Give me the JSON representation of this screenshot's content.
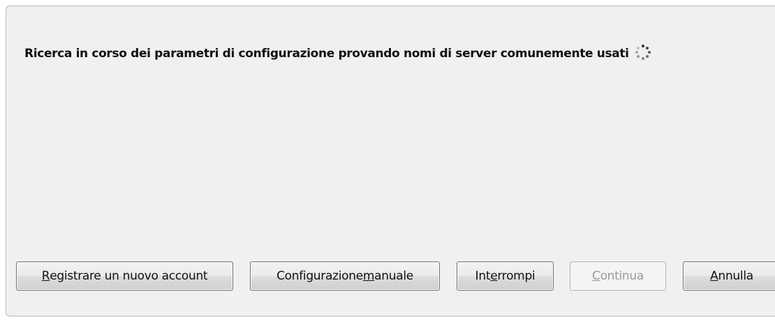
{
  "status": {
    "text": "Ricerca in corso dei parametri di configurazione provando nomi di server comunemente usati",
    "spinner_icon": "loading-spinner-icon"
  },
  "buttons": {
    "register": {
      "pre": "",
      "accel": "R",
      "post": "egistrare un nuovo account",
      "enabled": true
    },
    "manual": {
      "pre": "Configurazione ",
      "accel": "m",
      "post": "anuale",
      "enabled": true
    },
    "stop": {
      "pre": "Int",
      "accel": "e",
      "post": "rrompi",
      "enabled": true
    },
    "continue": {
      "pre": "",
      "accel": "C",
      "post": "ontinua",
      "enabled": false
    },
    "cancel": {
      "pre": "",
      "accel": "A",
      "post": "nnulla",
      "enabled": true
    }
  },
  "colors": {
    "dialog_bg": "#f0f0f0",
    "disabled_text": "#9a9a9a"
  }
}
